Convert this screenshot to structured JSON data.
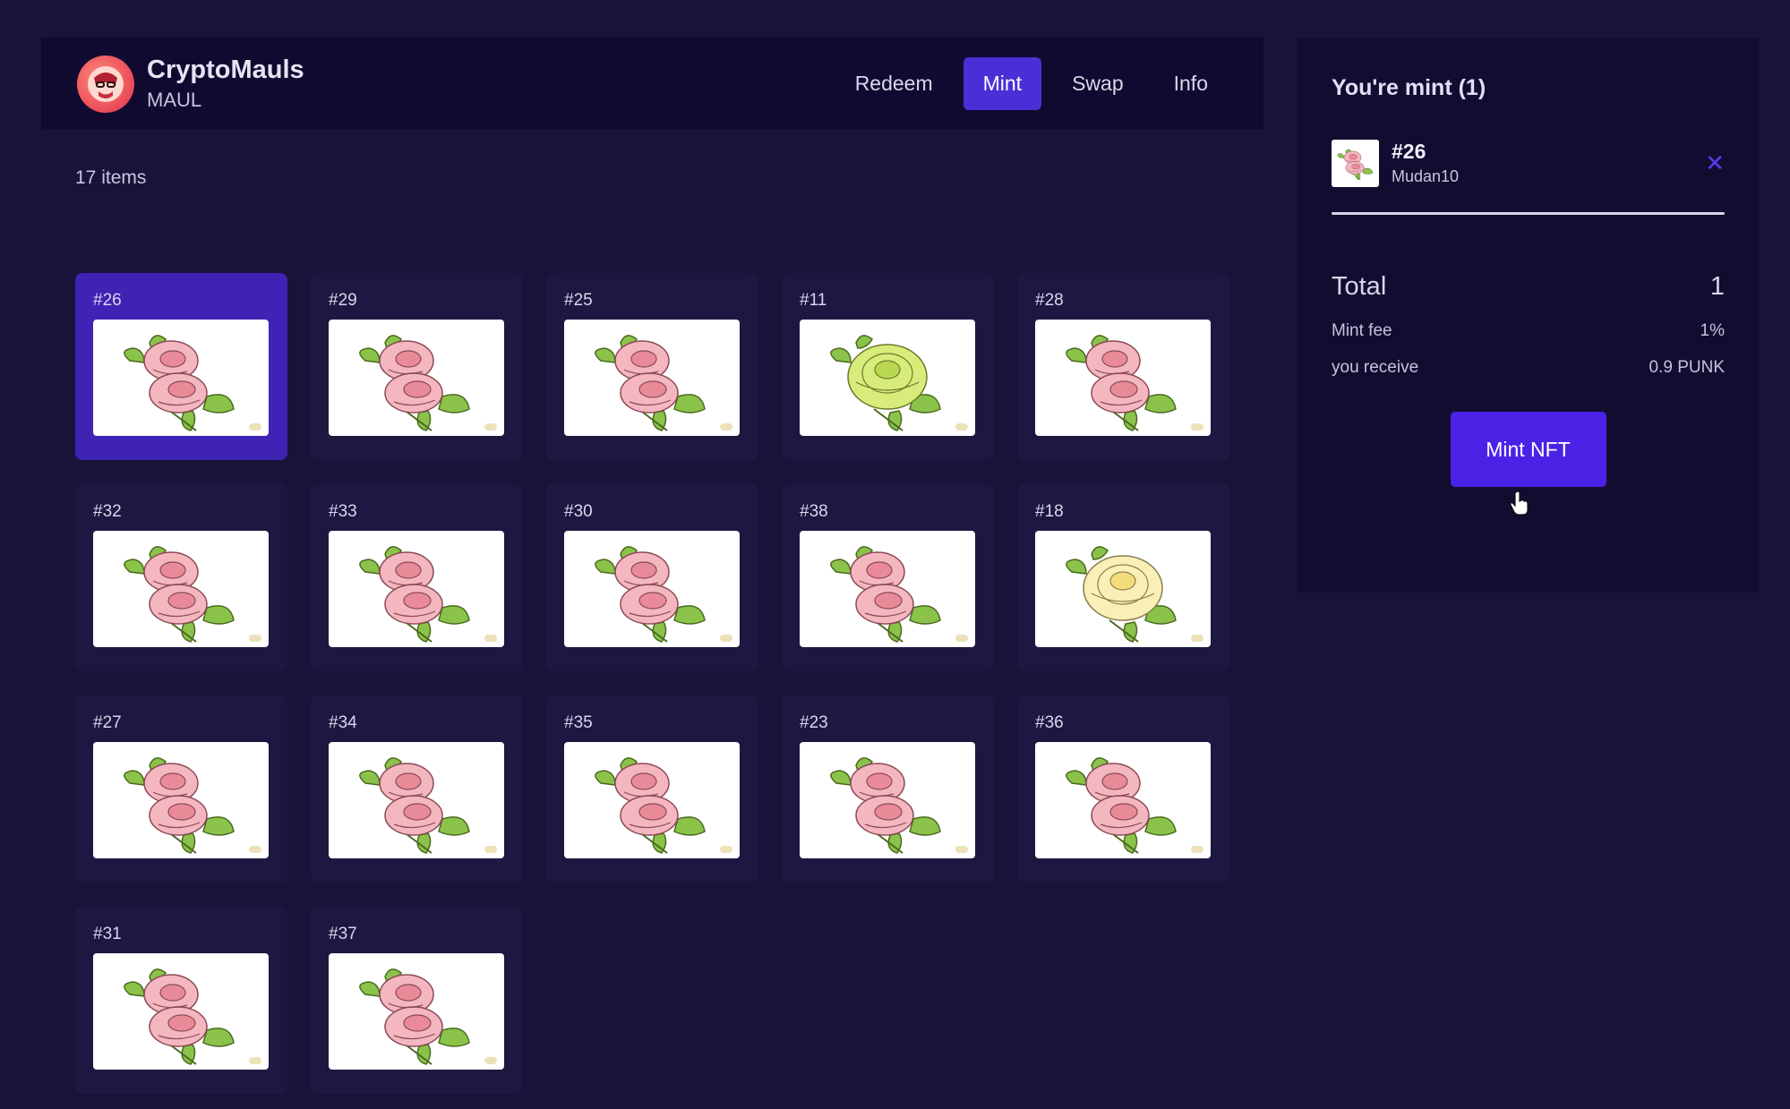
{
  "brand": {
    "name": "CryptoMauls",
    "symbol": "MAUL"
  },
  "nav": [
    {
      "label": "Redeem",
      "active": false
    },
    {
      "label": "Mint",
      "active": true
    },
    {
      "label": "Swap",
      "active": false
    },
    {
      "label": "Info",
      "active": false
    }
  ],
  "items_count": "17 items",
  "items": [
    {
      "id": "#26",
      "flower": "pink",
      "selected": true
    },
    {
      "id": "#29",
      "flower": "pink"
    },
    {
      "id": "#25",
      "flower": "pink"
    },
    {
      "id": "#11",
      "flower": "green"
    },
    {
      "id": "#28",
      "flower": "pink"
    },
    {
      "id": "#32",
      "flower": "pink"
    },
    {
      "id": "#33",
      "flower": "pink"
    },
    {
      "id": "#30",
      "flower": "pink"
    },
    {
      "id": "#38",
      "flower": "pink"
    },
    {
      "id": "#18",
      "flower": "cream"
    },
    {
      "id": "#27",
      "flower": "pink"
    },
    {
      "id": "#34",
      "flower": "pink"
    },
    {
      "id": "#35",
      "flower": "pink"
    },
    {
      "id": "#23",
      "flower": "pink"
    },
    {
      "id": "#36",
      "flower": "pink"
    },
    {
      "id": "#31",
      "flower": "pink"
    },
    {
      "id": "#37",
      "flower": "pink"
    }
  ],
  "panel": {
    "title": "You're mint (1)",
    "selected": {
      "id": "#26",
      "name": "Mudan10"
    },
    "close_icon": "close-icon",
    "total_label": "Total",
    "total_value": "1",
    "fee_label": "Mint fee",
    "fee_value": "1%",
    "receive_label": "you receive",
    "receive_value": "0.9 PUNK",
    "button_label": "Mint NFT"
  },
  "colors": {
    "background": "#19133a",
    "header": "#100a30",
    "accent": "#4b2fd6",
    "card": "#1e1741",
    "card_selected": "#3f23b5"
  }
}
